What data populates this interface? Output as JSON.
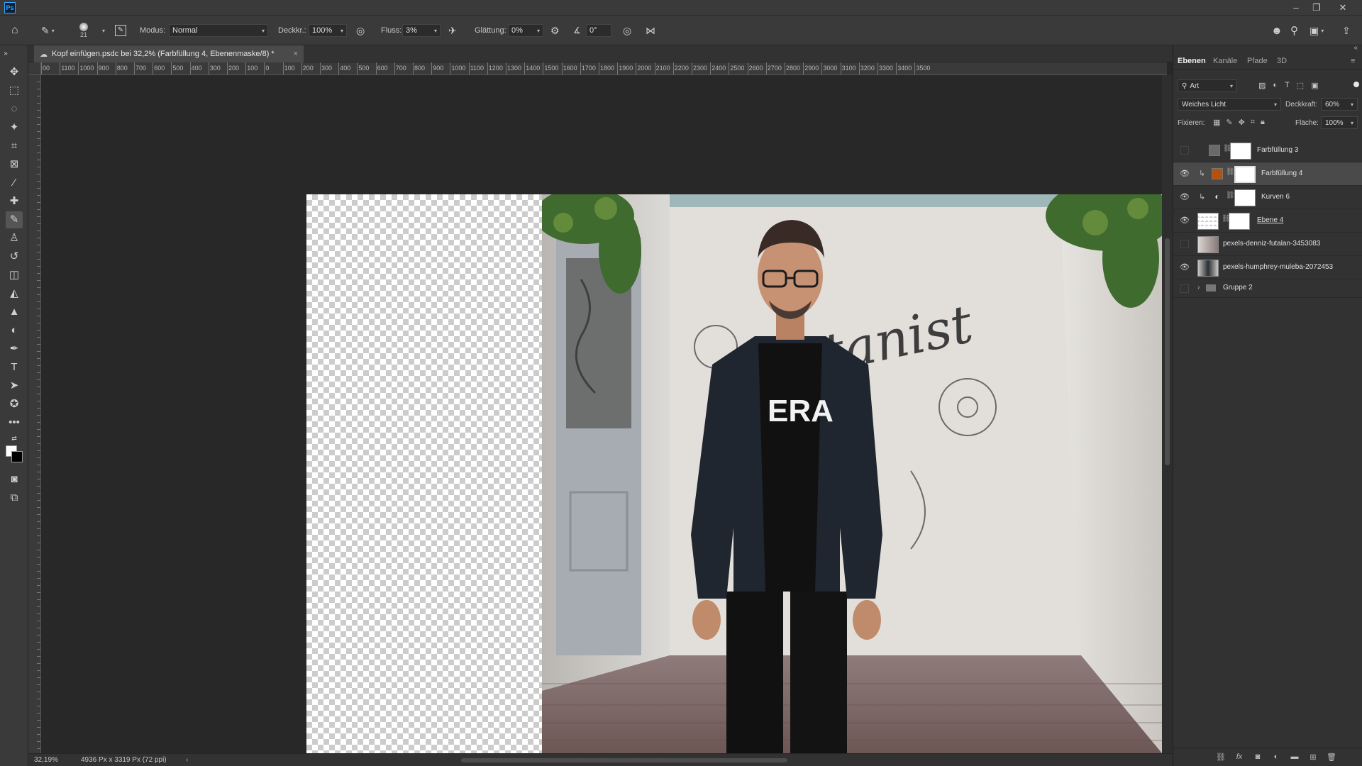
{
  "app": {
    "logo": "Ps"
  },
  "options": {
    "brush_size": "21",
    "mode_label": "Modus:",
    "mode_value": "Normal",
    "opacity_label": "Deckkr.:",
    "opacity_value": "100%",
    "flow_label": "Fluss:",
    "flow_value": "3%",
    "smoothing_label": "Glättung:",
    "smoothing_value": "0%",
    "angle_value": "0°"
  },
  "document": {
    "tab_title": "Kopf einfügen.psdc bei 32,2% (Farbfüllung 4, Ebenenmaske/8) *",
    "zoom": "32,19%",
    "size_info": "4936 Px x 3319 Px (72 ppi)"
  },
  "ruler": {
    "top_labels": [
      "00",
      "1100",
      "1000",
      "900",
      "800",
      "700",
      "600",
      "500",
      "400",
      "300",
      "200",
      "100",
      "0",
      "100",
      "200",
      "300",
      "400",
      "500",
      "600",
      "700",
      "800",
      "900",
      "1000",
      "1100",
      "1200",
      "1300",
      "1400",
      "1500",
      "1600",
      "1700",
      "1800",
      "1900",
      "2000",
      "2100",
      "2200",
      "2300",
      "2400",
      "2500",
      "2600",
      "2700",
      "2800",
      "2900",
      "3000",
      "3100",
      "3200",
      "3300",
      "3400",
      "3500"
    ]
  },
  "panel": {
    "tabs": [
      "Ebenen",
      "Kanäle",
      "Pfade",
      "3D"
    ],
    "filter_label": "Art",
    "blend_mode": "Weiches Licht",
    "opacity_label": "Deckkraft:",
    "opacity_value": "60%",
    "lock_label": "Fixieren:",
    "fill_label": "Fläche:",
    "fill_value": "100%",
    "layers": [
      {
        "name": "Farbfüllung 3",
        "visible": false,
        "swatch": "#6a6a6a"
      },
      {
        "name": "Farbfüllung 4",
        "visible": true,
        "swatch": "#b4520c",
        "selected": true
      },
      {
        "name": "Kurven 6",
        "visible": true
      },
      {
        "name": "Ebene 4",
        "visible": true
      },
      {
        "name": "pexels-denniz-futalan-3453083",
        "visible": false
      },
      {
        "name": "pexels-humphrey-muleba-2072453",
        "visible": true
      },
      {
        "name": "Gruppe 2",
        "visible": false
      }
    ]
  }
}
